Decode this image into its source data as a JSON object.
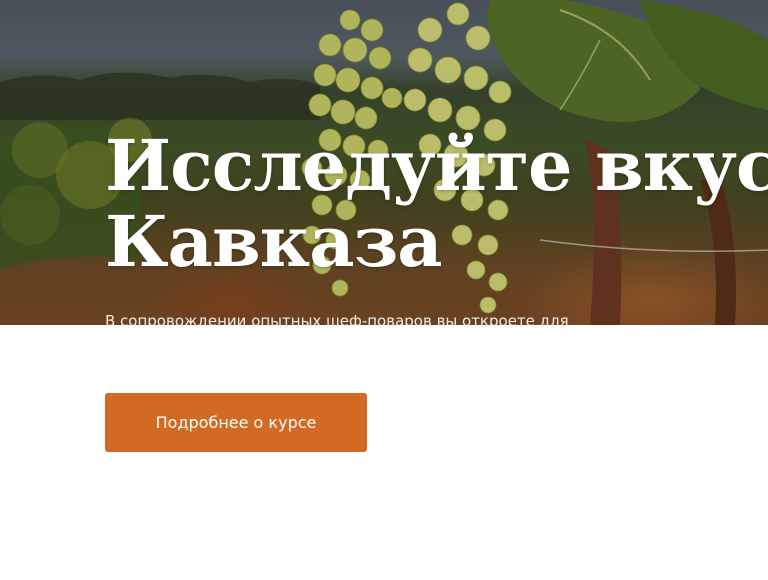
{
  "hero": {
    "title_line1": "Исследуйте вкусы",
    "title_line2": "Кавказа",
    "subtitle": "В сопровождении опытных шеф-поваров вы откроете для"
  },
  "cta": {
    "label": "Подробнее о курсе"
  },
  "colors": {
    "accent": "#d26a23",
    "title_text": "#ffffff",
    "page_background": "#ffffff"
  },
  "icons": [
    "vineyard-grapes-image"
  ]
}
